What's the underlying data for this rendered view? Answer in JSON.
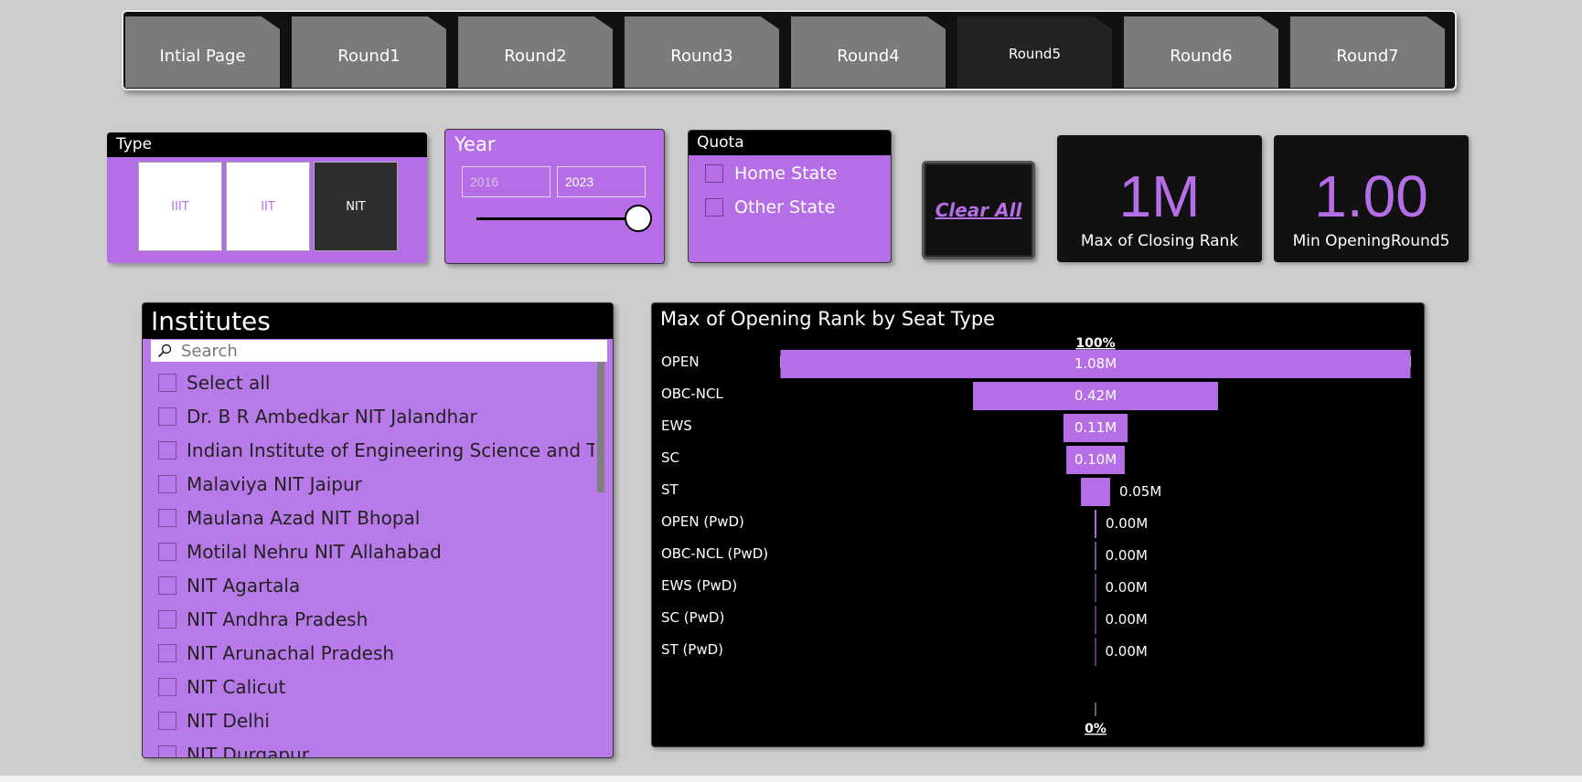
{
  "nav": {
    "tabs": [
      "Intial Page",
      "Round1",
      "Round2",
      "Round3",
      "Round4",
      "Round5",
      "Round6",
      "Round7"
    ],
    "active": "Round5"
  },
  "type_slicer": {
    "title": "Type",
    "options": [
      "IIIT",
      "IIT",
      "NIT"
    ],
    "selected": "NIT"
  },
  "year_slicer": {
    "title": "Year",
    "from": "2016",
    "to": "2023"
  },
  "quota_slicer": {
    "title": "Quota",
    "options": [
      "Home State",
      "Other State"
    ]
  },
  "clear_all": "Clear All",
  "cards": [
    {
      "value": "1M",
      "label": "Max of Closing Rank"
    },
    {
      "value": "1.00",
      "label": "Min  OpeningRound5"
    }
  ],
  "institutes": {
    "title": "Institutes",
    "search_placeholder": "Search",
    "items": [
      "Select all",
      "Dr. B R Ambedkar NIT Jalandhar",
      "Indian Institute of Engineering Science and Tech...",
      "Malaviya NIT Jaipur",
      "Maulana Azad NIT Bhopal",
      "Motilal Nehru NIT Allahabad",
      "NIT Agartala",
      "NIT Andhra Pradesh",
      "NIT Arunachal Pradesh",
      "NIT Calicut",
      "NIT Delhi",
      "NIT Durgapur"
    ]
  },
  "colors": {
    "accent": "#b56ee6",
    "panel_dark": "#111111"
  },
  "chart_data": {
    "type": "bar",
    "title": "Max of Opening Rank by Seat Type",
    "top_label": "100%",
    "bottom_label": "0%",
    "categories": [
      "OPEN",
      "OBC-NCL",
      "EWS",
      "SC",
      "ST",
      "OPEN (PwD)",
      "OBC-NCL (PwD)",
      "EWS (PwD)",
      "SC (PwD)",
      "ST (PwD)"
    ],
    "values": [
      1.08,
      0.42,
      0.11,
      0.1,
      0.05,
      0.003,
      0.002,
      0.001,
      0.001,
      0.0005
    ],
    "labels": [
      "1.08M",
      "0.42M",
      "0.11M",
      "0.10M",
      "0.05M",
      "0.00M",
      "0.00M",
      "0.00M",
      "0.00M",
      "0.00M"
    ]
  }
}
